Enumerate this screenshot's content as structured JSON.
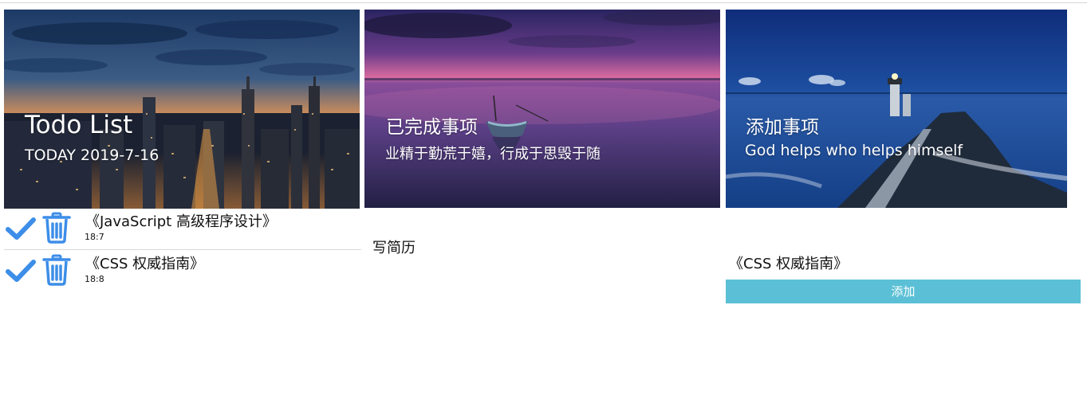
{
  "panels": {
    "todo": {
      "title": "Todo List",
      "subtitle": "TODAY 2019-7-16",
      "items": [
        {
          "title": "《JavaScript 高级程序设计》",
          "time": "18:7"
        },
        {
          "title": "《CSS 权威指南》",
          "time": "18:8"
        }
      ]
    },
    "done": {
      "title": "已完成事项",
      "subtitle": "业精于勤荒于嬉，行成于思毁于随",
      "items": [
        {
          "title": "写简历"
        }
      ]
    },
    "add": {
      "title": "添加事项",
      "subtitle": "God helps who helps himself",
      "input_value": "《CSS 权威指南》",
      "button_label": "添加"
    }
  },
  "icons": {
    "check": "check-icon",
    "trash": "trash-icon"
  },
  "colors": {
    "icon_blue": "#3d8ee8",
    "add_button": "#5bc0d6",
    "banner_text": "#ffffff"
  }
}
